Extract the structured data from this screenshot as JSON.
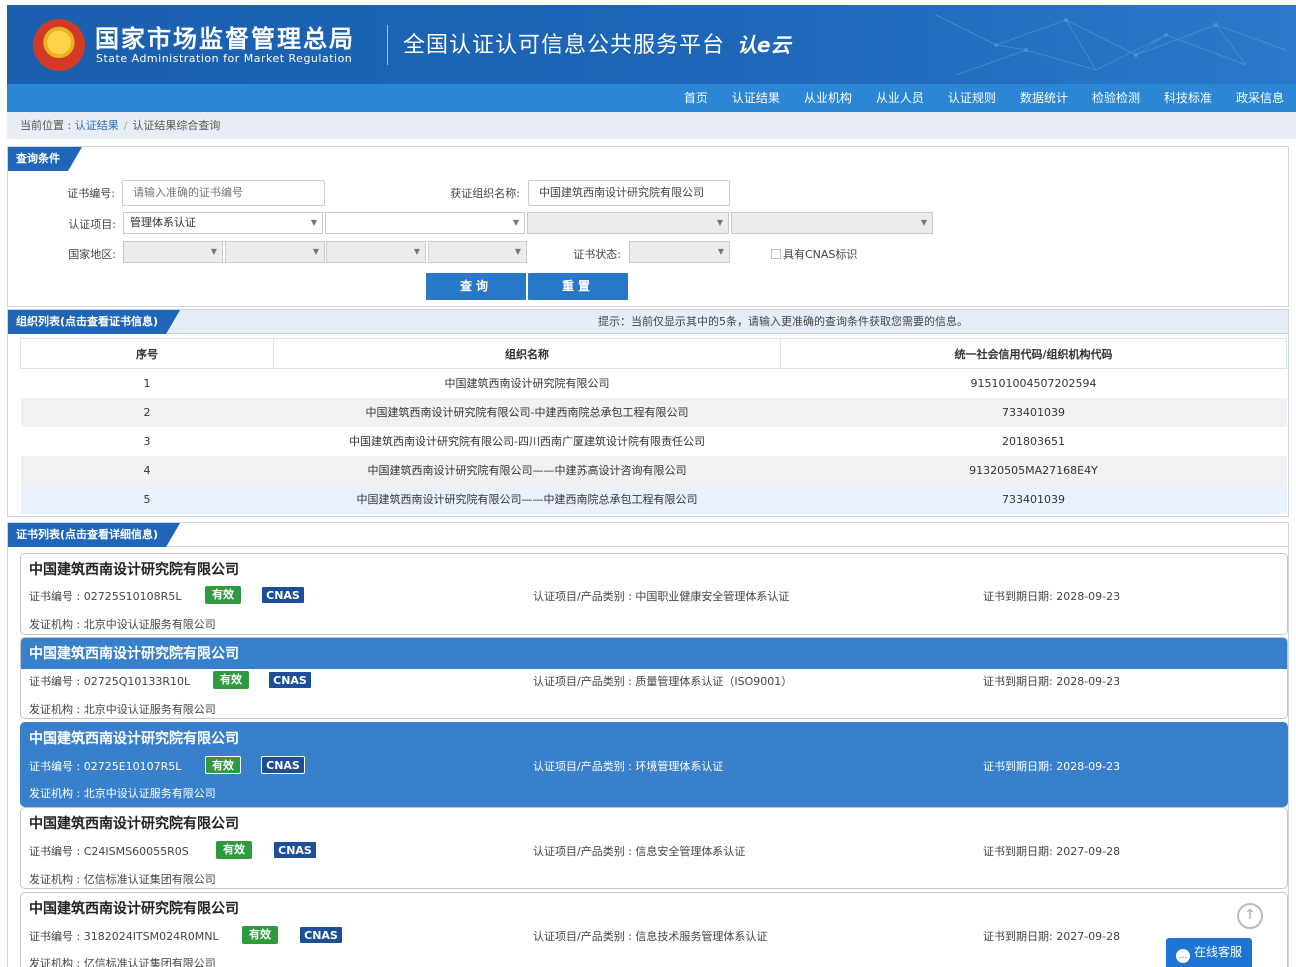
{
  "header": {
    "org_cn": "国家市场监督管理总局",
    "org_en": "State Administration  for  Market Regulation",
    "platform": "全国认证认可信息公共服务平台",
    "platform_logo": "认e云",
    "brand_color": "#1e64b4"
  },
  "nav": {
    "items": [
      "首页",
      "认证结果",
      "从业机构",
      "从业人员",
      "认证规则",
      "数据统计",
      "检验检测",
      "科技标准",
      "政采信息"
    ]
  },
  "breadcrumb": {
    "prefix": "当前位置 : ",
    "level1": "认证结果",
    "sep": "/",
    "level2": "认证结果综合查询"
  },
  "query": {
    "section_title": "查询条件",
    "cert_no_label": "证书编号:",
    "cert_no_placeholder": "请输入准确的证书编号",
    "org_name_label": "获证组织名称:",
    "org_name_value": "中国建筑西南设计研究院有限公司",
    "project_label": "认证项目:",
    "project_value": "管理体系认证",
    "region_label": "国家地区:",
    "status_label": "证书状态:",
    "cnas_label": "具有CNAS标识",
    "search_button": "查询",
    "reset_button": "重置"
  },
  "org_list": {
    "section_title": "组织列表(点击查看证书信息)",
    "hint": "提示：当前仅显示其中的5条，请输入更准确的查询条件获取您需要的信息。",
    "columns": [
      "序号",
      "组织名称",
      "统一社会信用代码/组织机构代码"
    ],
    "rows": [
      {
        "no": "1",
        "name": "中国建筑西南设计研究院有限公司",
        "code": "915101004507202594"
      },
      {
        "no": "2",
        "name": "中国建筑西南设计研究院有限公司-中建西南院总承包工程有限公司",
        "code": "733401039"
      },
      {
        "no": "3",
        "name": "中国建筑西南设计研究院有限公司-四川西南广厦建筑设计院有限责任公司",
        "code": "201803651"
      },
      {
        "no": "4",
        "name": "中国建筑西南设计研究院有限公司——中建苏高设计咨询有限公司",
        "code": "91320505MA27168E4Y"
      },
      {
        "no": "5",
        "name": "中国建筑西南设计研究院有限公司——中建西南院总承包工程有限公司",
        "code": "733401039"
      }
    ]
  },
  "cert_list": {
    "section_title": "证书列表(点击查看详细信息)",
    "cert_no_prefix": "证书编号 : ",
    "project_prefix": "认证项目/产品类别 : ",
    "expiry_prefix": "证书到期日期: ",
    "issuer_prefix": "发证机构 : ",
    "valid_badge": "有效",
    "cnas_badge": "CNAS",
    "items": [
      {
        "org": "中国建筑西南设计研究院有限公司",
        "cert_no": "02725S10108R5L",
        "project": "中国职业健康安全管理体系认证",
        "expiry": "2028-09-23",
        "issuer": "北京中设认证服务有限公司"
      },
      {
        "org": "中国建筑西南设计研究院有限公司",
        "cert_no": "02725Q10133R10L",
        "project": "质量管理体系认证（ISO9001）",
        "expiry": "2028-09-23",
        "issuer": "北京中设认证服务有限公司"
      },
      {
        "org": "中国建筑西南设计研究院有限公司",
        "cert_no": "02725E10107R5L",
        "project": "环境管理体系认证",
        "expiry": "2028-09-23",
        "issuer": "北京中设认证服务有限公司"
      },
      {
        "org": "中国建筑西南设计研究院有限公司",
        "cert_no": "C24ISMS60055R0S",
        "project": "信息安全管理体系认证",
        "expiry": "2027-09-28",
        "issuer": "亿信标准认证集团有限公司"
      },
      {
        "org": "中国建筑西南设计研究院有限公司",
        "cert_no": "3182024ITSM024R0MNL",
        "project": "信息技术服务管理体系认证",
        "expiry": "2027-09-28",
        "issuer": "亿信标准认证集团有限公司"
      }
    ]
  },
  "widgets": {
    "chat_label": "在线客服",
    "scroll_top_icon": "arrow-up-icon"
  }
}
